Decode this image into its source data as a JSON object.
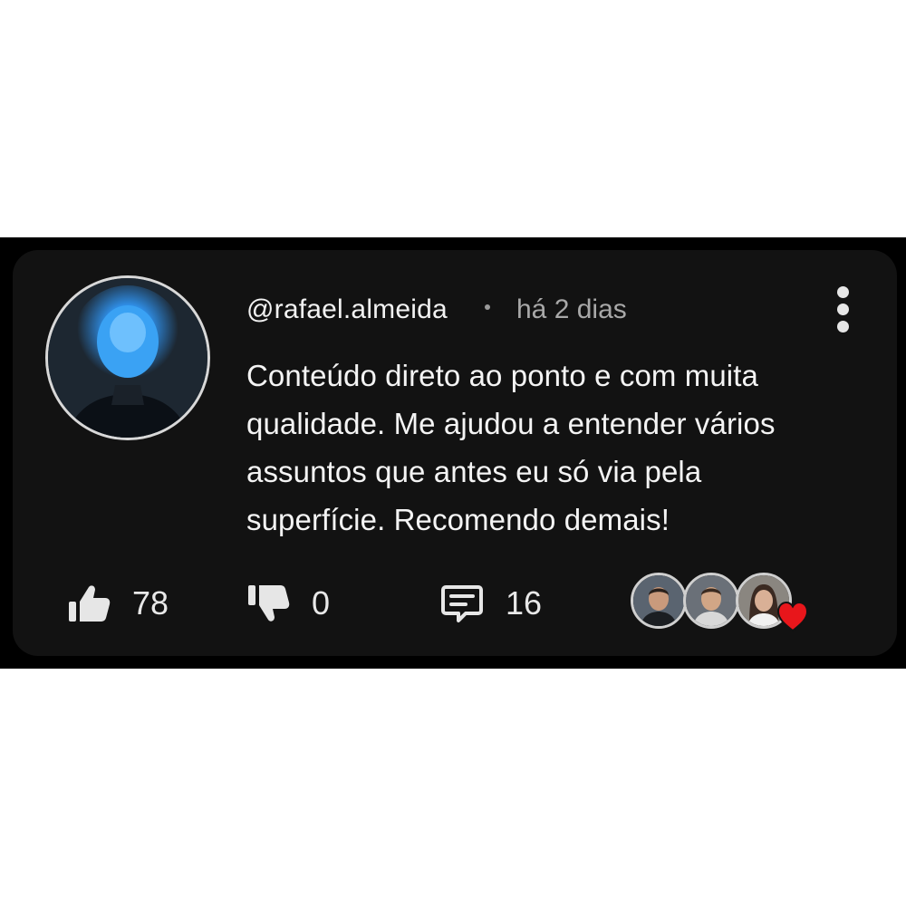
{
  "comment": {
    "username": "@rafael.almeida",
    "timestamp": "há 2 dias",
    "text": "Conteúdo direto ao ponto e com muita qualidade. Me ajudou a entender vários assuntos que antes eu só via pela superfície. Recomendo demais!"
  },
  "actions": {
    "likes": "78",
    "dislikes": "0",
    "replies": "16"
  },
  "icons": {
    "like": "thumbs-up-icon",
    "dislike": "thumbs-down-icon",
    "reply": "comment-icon",
    "more": "more-vertical-icon",
    "reaction": "heart-icon"
  },
  "colors": {
    "card_background": "#121212",
    "frame_background": "#000000",
    "text_primary": "#f4f4f4",
    "text_secondary": "#a8a8a8",
    "heart": "#e8161b"
  }
}
